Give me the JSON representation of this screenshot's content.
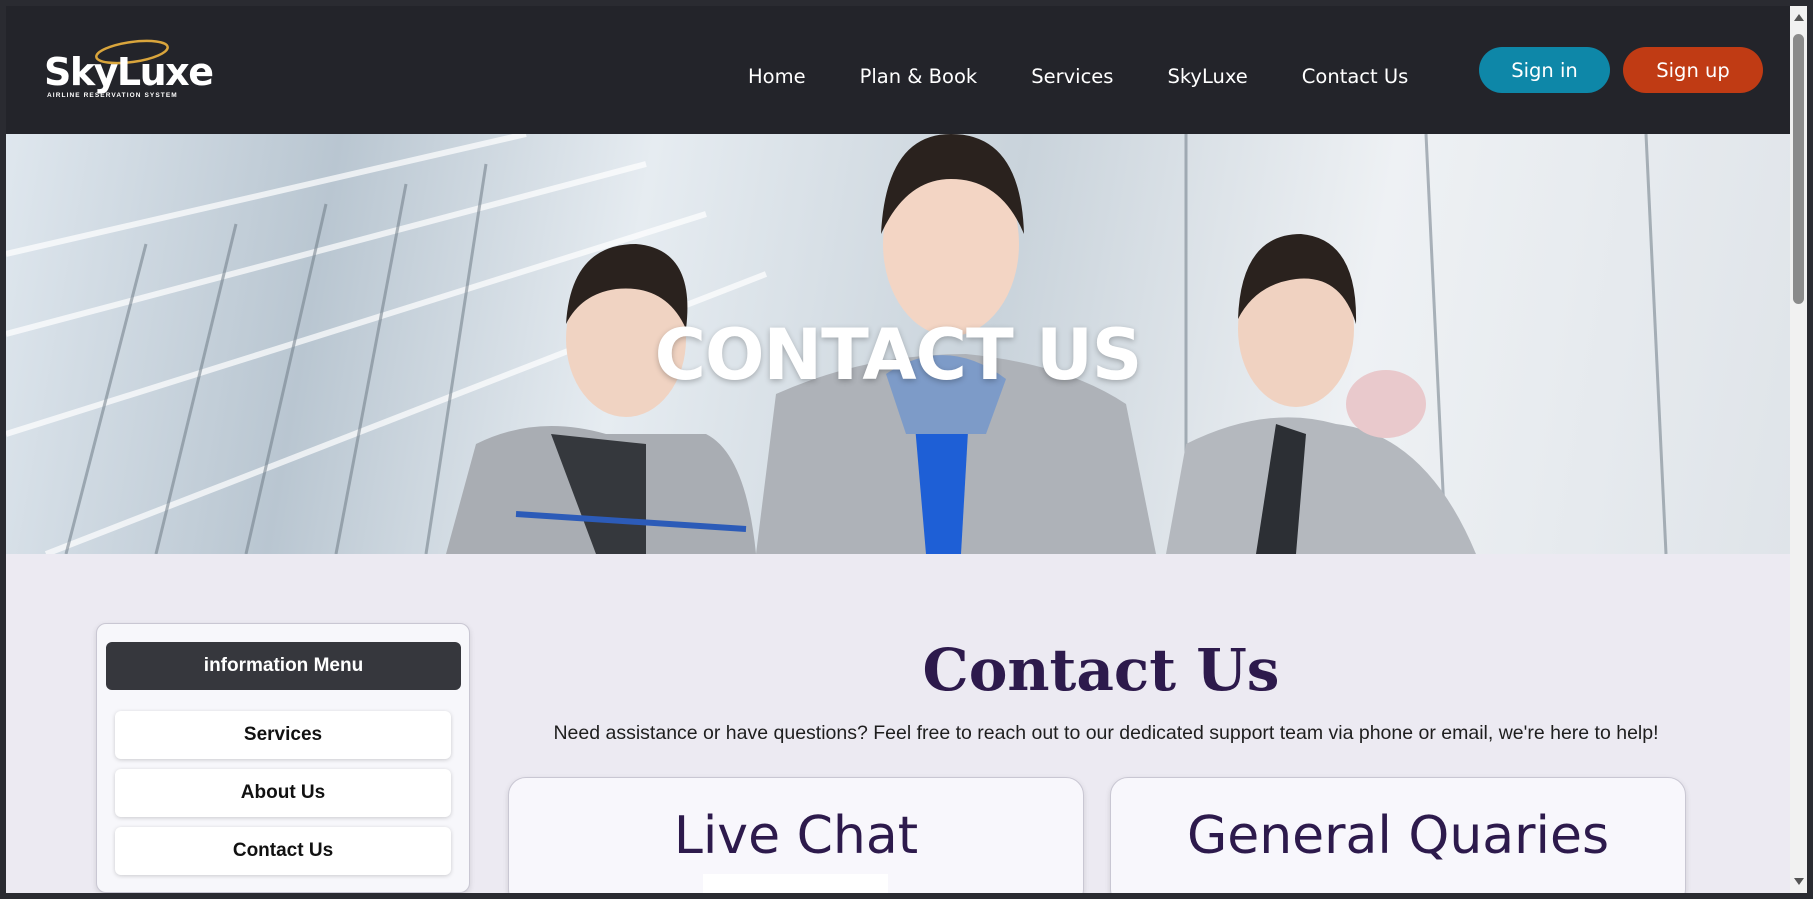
{
  "logo": {
    "name": "SkyLuxe",
    "tagline": "AIRLINE  RESERVATION SYSTEM"
  },
  "nav": {
    "links": [
      "Home",
      "Plan & Book",
      "Services",
      "SkyLuxe",
      "Contact Us"
    ],
    "signin": "Sign in",
    "signup": "Sign up"
  },
  "hero": {
    "title": "CONTACT US"
  },
  "sidebar": {
    "heading": "information Menu",
    "items": [
      "Services",
      "About Us",
      "Contact Us"
    ]
  },
  "main": {
    "title": "Contact Us",
    "description": "Need assistance or have questions? Feel free to reach out to our dedicated support team via phone or email, we're here to help!",
    "cards": [
      "Live Chat",
      "General Quaries"
    ]
  },
  "colors": {
    "nav_bg": "#23242a",
    "signin": "#0e87a8",
    "signup": "#c03b14",
    "heading_purple": "#2d1a4c",
    "page_bg": "#eceaf2"
  }
}
